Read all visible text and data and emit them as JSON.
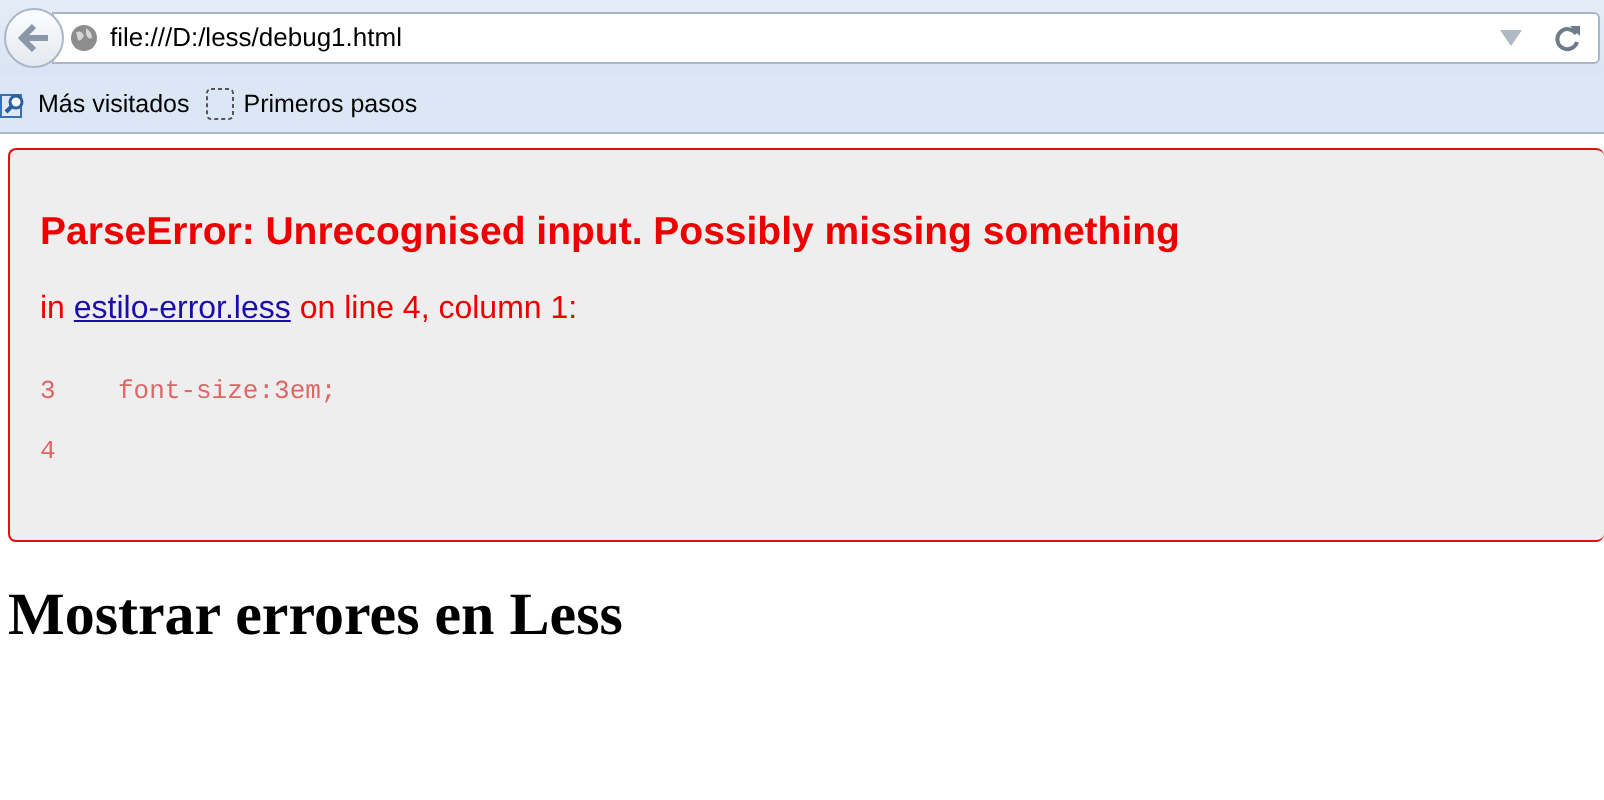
{
  "browser": {
    "address": "file:///D:/less/debug1.html",
    "bookmarks": [
      {
        "label": "Más visitados",
        "kind": "search"
      },
      {
        "label": "Primeros pasos",
        "kind": "blank"
      }
    ]
  },
  "error": {
    "title": "ParseError: Unrecognised input. Possibly missing something",
    "message": {
      "prefix": "in",
      "link": "estilo-error.less",
      "suffix": "on line 4, column 1:"
    },
    "lines": [
      {
        "number": "3",
        "code": "font-size:3em;"
      },
      {
        "number": "4"
      }
    ]
  },
  "heading": "Mostrar errores en Less"
}
